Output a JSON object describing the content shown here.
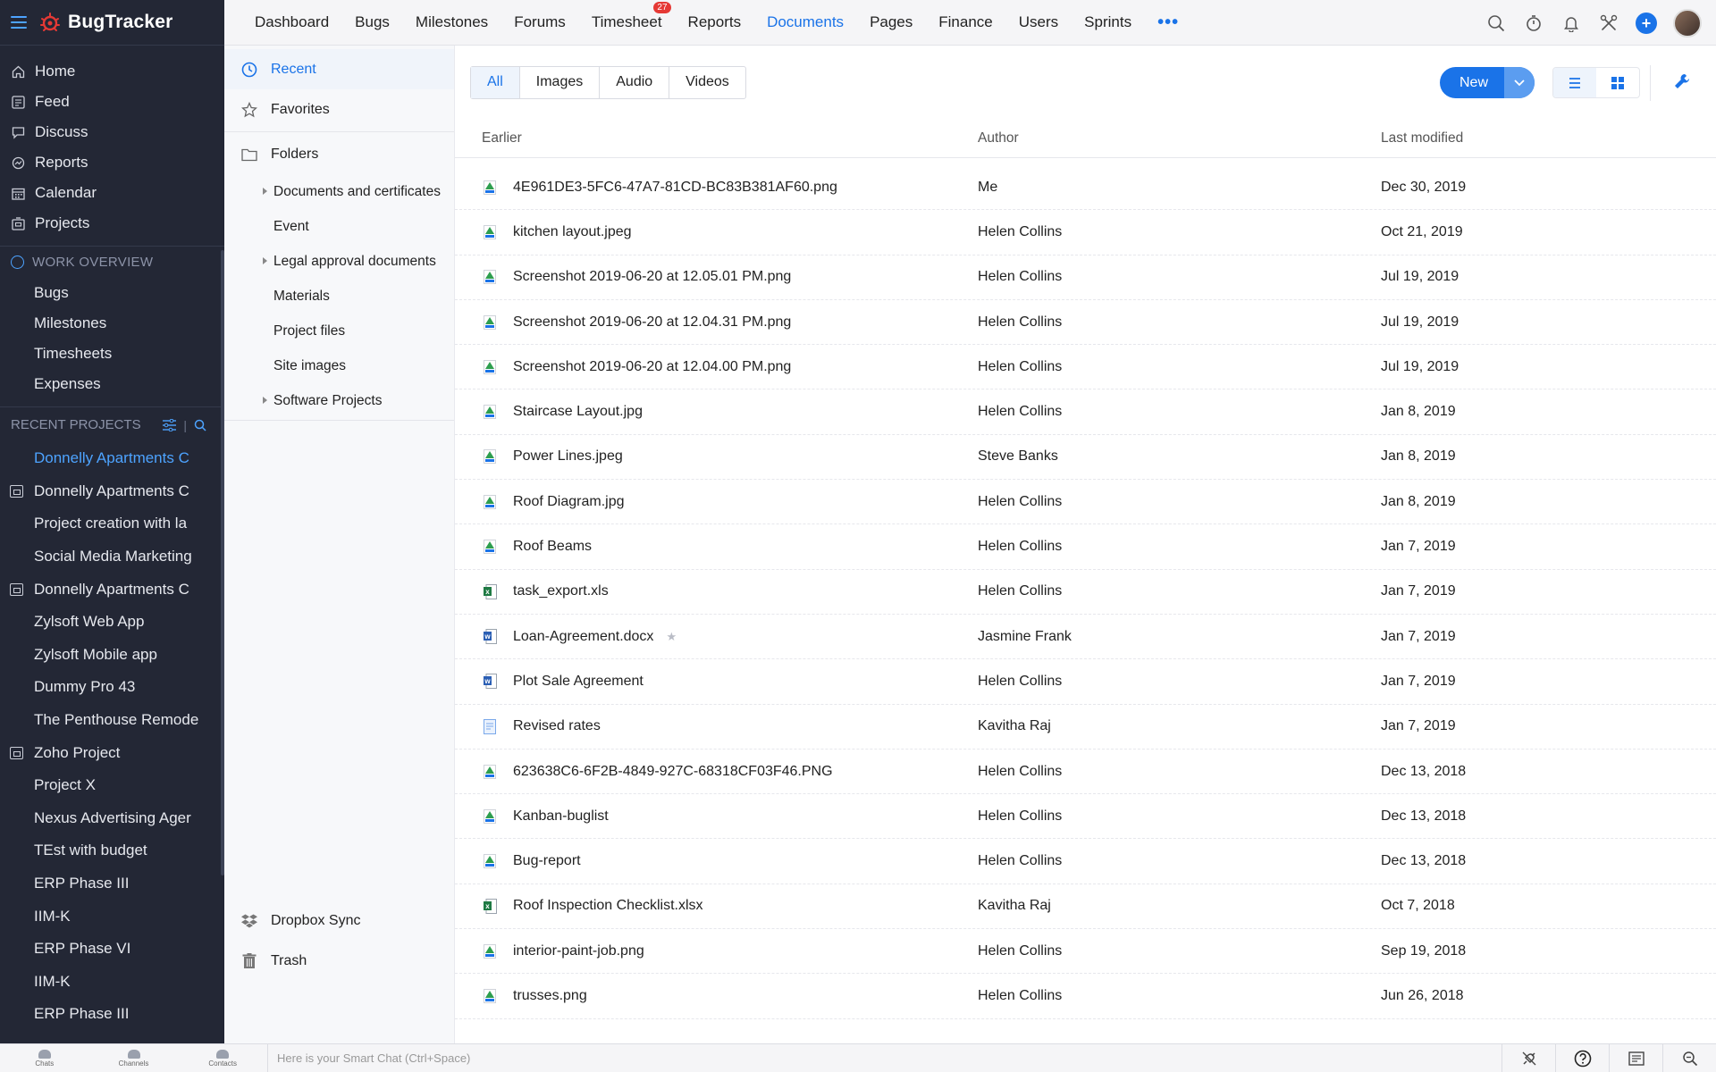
{
  "app": {
    "name": "BugTracker"
  },
  "sidebar": {
    "nav": [
      {
        "label": "Home",
        "icon": "home-icon"
      },
      {
        "label": "Feed",
        "icon": "feed-icon"
      },
      {
        "label": "Discuss",
        "icon": "discuss-icon"
      },
      {
        "label": "Reports",
        "icon": "reports-icon"
      },
      {
        "label": "Calendar",
        "icon": "calendar-icon"
      },
      {
        "label": "Projects",
        "icon": "projects-icon"
      }
    ],
    "work_overview": {
      "title": "WORK OVERVIEW",
      "items": [
        "Bugs",
        "Milestones",
        "Timesheets",
        "Expenses"
      ]
    },
    "recent_projects": {
      "title": "RECENT PROJECTS",
      "items": [
        {
          "label": "Donnelly Apartments C",
          "active": true,
          "icon": false
        },
        {
          "label": "Donnelly Apartments C",
          "icon": true
        },
        {
          "label": "Project creation with la",
          "icon": false
        },
        {
          "label": "Social Media Marketing",
          "icon": false
        },
        {
          "label": "Donnelly Apartments C",
          "icon": true
        },
        {
          "label": "Zylsoft Web App",
          "icon": false
        },
        {
          "label": "Zylsoft Mobile app",
          "icon": false
        },
        {
          "label": "Dummy Pro 43",
          "icon": false
        },
        {
          "label": "The Penthouse Remode",
          "icon": false
        },
        {
          "label": "Zoho Project",
          "icon": true
        },
        {
          "label": "Project X",
          "icon": false
        },
        {
          "label": "Nexus Advertising Ager",
          "icon": false
        },
        {
          "label": "TEst with budget",
          "icon": false
        },
        {
          "label": "ERP Phase III",
          "icon": false
        },
        {
          "label": "IIM-K",
          "icon": false
        },
        {
          "label": "ERP Phase VI",
          "icon": false
        },
        {
          "label": "IIM-K",
          "icon": false
        },
        {
          "label": "ERP Phase III",
          "icon": false
        }
      ]
    }
  },
  "topnav": {
    "items": [
      {
        "label": "Dashboard"
      },
      {
        "label": "Bugs"
      },
      {
        "label": "Milestones"
      },
      {
        "label": "Forums"
      },
      {
        "label": "Timesheet",
        "badge": "27"
      },
      {
        "label": "Reports"
      },
      {
        "label": "Documents",
        "active": true
      },
      {
        "label": "Pages"
      },
      {
        "label": "Finance"
      },
      {
        "label": "Users"
      },
      {
        "label": "Sprints"
      }
    ],
    "more": "•••"
  },
  "folders": {
    "recent": "Recent",
    "favorites": "Favorites",
    "folders": "Folders",
    "tree": [
      {
        "label": "Documents and certificates",
        "expandable": true
      },
      {
        "label": "Event",
        "expandable": false
      },
      {
        "label": "Legal approval documents",
        "expandable": true
      },
      {
        "label": "Materials",
        "expandable": false
      },
      {
        "label": "Project files",
        "expandable": false
      },
      {
        "label": "Site images",
        "expandable": false
      },
      {
        "label": "Software Projects",
        "expandable": true
      }
    ],
    "dropbox": "Dropbox Sync",
    "trash": "Trash"
  },
  "filter_tabs": [
    "All",
    "Images",
    "Audio",
    "Videos"
  ],
  "new_button": "New",
  "table": {
    "headers": {
      "name": "Earlier",
      "author": "Author",
      "date": "Last modified"
    },
    "rows": [
      {
        "name": "4E961DE3-5FC6-47A7-81CD-BC83B381AF60.png",
        "type": "image",
        "author": "Me",
        "date": "Dec 30, 2019"
      },
      {
        "name": "kitchen layout.jpeg",
        "type": "image",
        "author": "Helen Collins",
        "date": "Oct 21, 2019"
      },
      {
        "name": "Screenshot 2019-06-20 at 12.05.01 PM.png",
        "type": "image",
        "author": "Helen Collins",
        "date": "Jul 19, 2019"
      },
      {
        "name": "Screenshot 2019-06-20 at 12.04.31 PM.png",
        "type": "image",
        "author": "Helen Collins",
        "date": "Jul 19, 2019"
      },
      {
        "name": "Screenshot 2019-06-20 at 12.04.00 PM.png",
        "type": "image",
        "author": "Helen Collins",
        "date": "Jul 19, 2019"
      },
      {
        "name": "Staircase Layout.jpg",
        "type": "image",
        "author": "Helen Collins",
        "date": "Jan 8, 2019"
      },
      {
        "name": "Power Lines.jpeg",
        "type": "image",
        "author": "Steve Banks",
        "date": "Jan 8, 2019"
      },
      {
        "name": "Roof Diagram.jpg",
        "type": "image",
        "author": "Helen Collins",
        "date": "Jan 8, 2019"
      },
      {
        "name": "Roof Beams",
        "type": "image",
        "author": "Helen Collins",
        "date": "Jan 7, 2019"
      },
      {
        "name": "task_export.xls",
        "type": "excel",
        "author": "Helen Collins",
        "date": "Jan 7, 2019"
      },
      {
        "name": "Loan-Agreement.docx",
        "type": "word",
        "author": "Jasmine Frank",
        "date": "Jan 7, 2019",
        "star": true
      },
      {
        "name": "Plot Sale Agreement",
        "type": "word",
        "author": "Helen Collins",
        "date": "Jan 7, 2019"
      },
      {
        "name": "Revised rates",
        "type": "doc",
        "author": "Kavitha Raj",
        "date": "Jan 7, 2019"
      },
      {
        "name": "623638C6-6F2B-4849-927C-68318CF03F46.PNG",
        "type": "image",
        "author": "Helen Collins",
        "date": "Dec 13, 2018"
      },
      {
        "name": "Kanban-buglist",
        "type": "image",
        "author": "Helen Collins",
        "date": "Dec 13, 2018"
      },
      {
        "name": "Bug-report",
        "type": "image",
        "author": "Helen Collins",
        "date": "Dec 13, 2018"
      },
      {
        "name": "Roof Inspection Checklist.xlsx",
        "type": "excel",
        "author": "Kavitha Raj",
        "date": "Oct 7, 2018"
      },
      {
        "name": "interior-paint-job.png",
        "type": "image",
        "author": "Helen Collins",
        "date": "Sep 19, 2018"
      },
      {
        "name": "trusses.png",
        "type": "image",
        "author": "Helen Collins",
        "date": "Jun 26, 2018"
      }
    ]
  },
  "bottombar": {
    "tabs": [
      "Chats",
      "Channels",
      "Contacts"
    ],
    "smart_chat_placeholder": "Here is your Smart Chat (Ctrl+Space)"
  },
  "colors": {
    "accent": "#1a73e8",
    "sidebar_bg": "#232735"
  }
}
